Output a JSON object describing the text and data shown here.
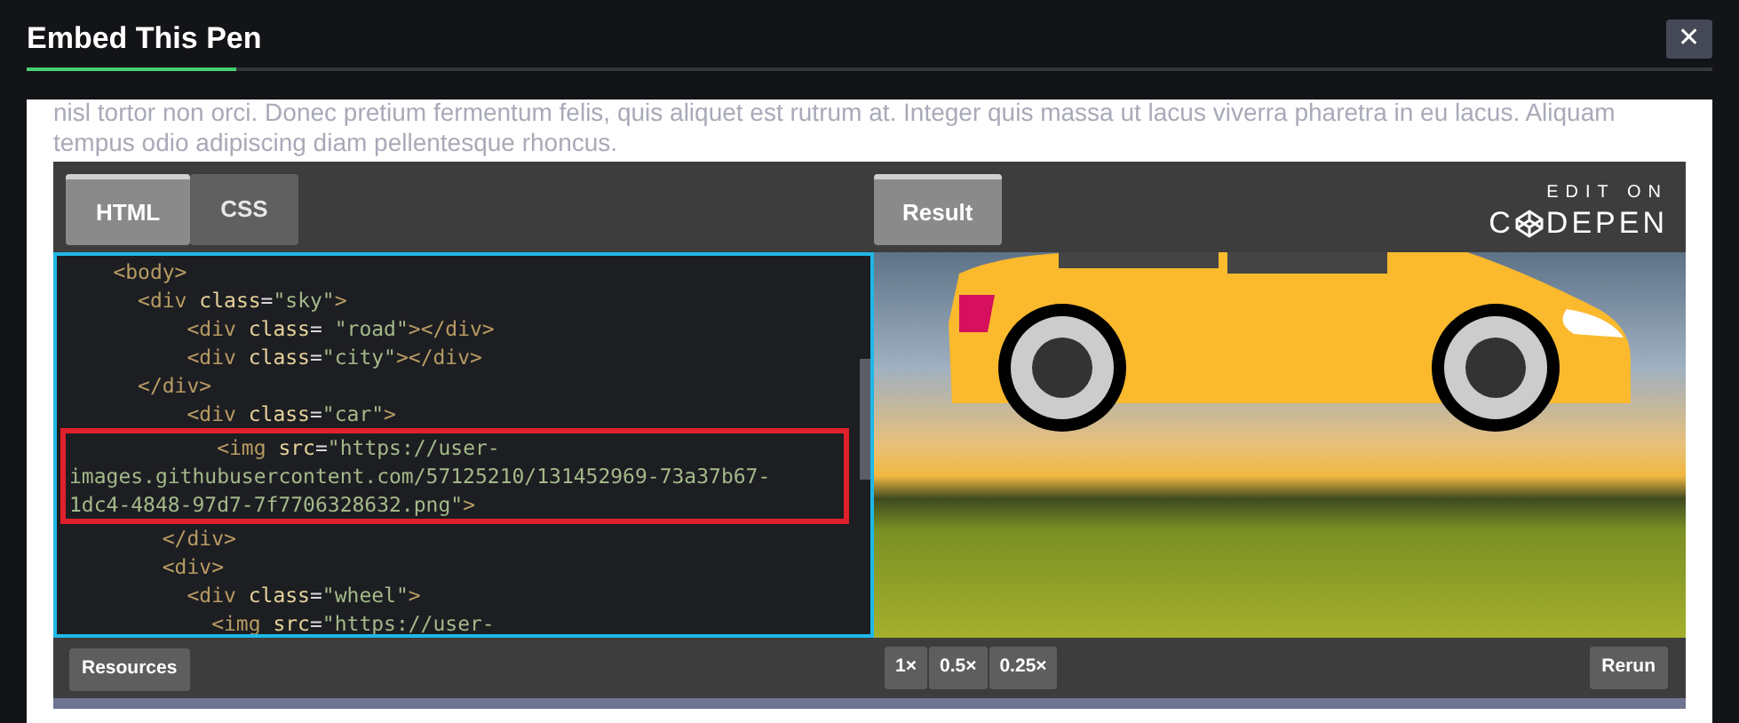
{
  "dialog": {
    "title": "Embed This Pen",
    "close": "✕"
  },
  "intro_text": [
    "nisl tortor non orci. Donec pretium fermentum felis, quis aliquet est rutrum at. Integer quis massa ut lacus viverra pharetra in eu lacus. Aliquam",
    "tempus odio adipiscing diam pellentesque rhoncus."
  ],
  "embed": {
    "tabs": [
      {
        "label": "HTML",
        "selected": true
      },
      {
        "label": "CSS",
        "selected": false
      }
    ],
    "result_tab": {
      "label": "Result",
      "selected": true
    },
    "edit_on": {
      "line1": "EDIT ON",
      "brand_pre": "C",
      "brand_post": "DEPEN"
    },
    "code_lines": [
      {
        "highlighted": false,
        "tokens": [
          {
            "kind": "tag",
            "text": "    <body>"
          }
        ]
      },
      {
        "highlighted": false,
        "tokens": [
          {
            "kind": "tag",
            "text": "      <div "
          },
          {
            "kind": "attr",
            "text": "class"
          },
          {
            "kind": "punct",
            "text": "="
          },
          {
            "kind": "string",
            "text": "\"sky\""
          },
          {
            "kind": "tag",
            "text": ">"
          }
        ]
      },
      {
        "highlighted": false,
        "tokens": [
          {
            "kind": "tag",
            "text": "          <div "
          },
          {
            "kind": "attr",
            "text": "class"
          },
          {
            "kind": "punct",
            "text": "= "
          },
          {
            "kind": "string",
            "text": "\"road\""
          },
          {
            "kind": "tag",
            "text": "></div>"
          }
        ]
      },
      {
        "highlighted": false,
        "tokens": [
          {
            "kind": "tag",
            "text": "          <div "
          },
          {
            "kind": "attr",
            "text": "class"
          },
          {
            "kind": "punct",
            "text": "="
          },
          {
            "kind": "string",
            "text": "\"city\""
          },
          {
            "kind": "tag",
            "text": "></div>"
          }
        ]
      },
      {
        "highlighted": false,
        "tokens": [
          {
            "kind": "tag",
            "text": "      </div>"
          }
        ]
      },
      {
        "highlighted": false,
        "tokens": [
          {
            "kind": "tag",
            "text": "          <div "
          },
          {
            "kind": "attr",
            "text": "class"
          },
          {
            "kind": "punct",
            "text": "="
          },
          {
            "kind": "string",
            "text": "\"car\""
          },
          {
            "kind": "tag",
            "text": ">"
          }
        ]
      },
      {
        "highlighted": true,
        "tokens": [
          {
            "kind": "tag",
            "text": "            <img "
          },
          {
            "kind": "attr",
            "text": "src"
          },
          {
            "kind": "punct",
            "text": "="
          },
          {
            "kind": "string",
            "text": "\"https://user-"
          }
        ]
      },
      {
        "highlighted": true,
        "tokens": [
          {
            "kind": "string",
            "text": "images.githubusercontent.com/57125210/131452969-73a37b67-"
          }
        ]
      },
      {
        "highlighted": true,
        "tokens": [
          {
            "kind": "string",
            "text": "1dc4-4848-97d7-7f7706328632.png\""
          },
          {
            "kind": "tag",
            "text": ">"
          }
        ]
      },
      {
        "highlighted": false,
        "tokens": [
          {
            "kind": "tag",
            "text": "        </div>"
          }
        ]
      },
      {
        "highlighted": false,
        "tokens": [
          {
            "kind": "tag",
            "text": "        <div>"
          }
        ]
      },
      {
        "highlighted": false,
        "tokens": [
          {
            "kind": "tag",
            "text": "          <div "
          },
          {
            "kind": "attr",
            "text": "class"
          },
          {
            "kind": "punct",
            "text": "="
          },
          {
            "kind": "string",
            "text": "\"wheel\""
          },
          {
            "kind": "tag",
            "text": ">"
          }
        ]
      },
      {
        "highlighted": false,
        "tokens": [
          {
            "kind": "tag",
            "text": "            <img "
          },
          {
            "kind": "attr",
            "text": "src"
          },
          {
            "kind": "punct",
            "text": "="
          },
          {
            "kind": "string",
            "text": "\"https://user-"
          }
        ]
      }
    ],
    "resources_button": "Resources",
    "zoom_buttons": [
      {
        "label": "1×"
      },
      {
        "label": "0.5×"
      },
      {
        "label": "0.25×"
      }
    ],
    "rerun_button": "Rerun"
  }
}
